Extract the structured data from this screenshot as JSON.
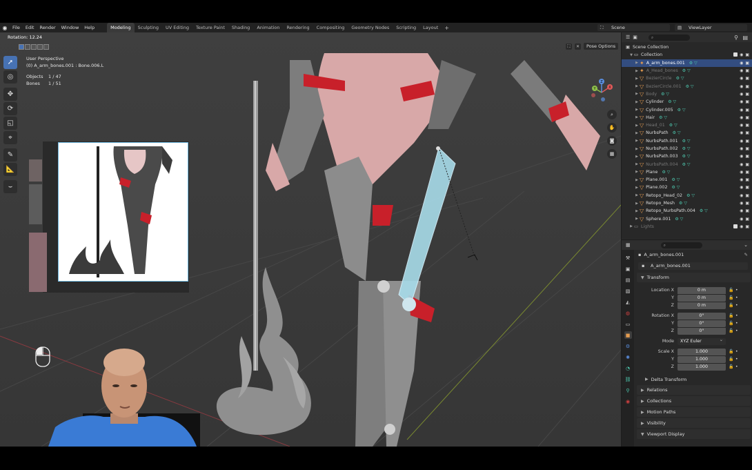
{
  "menubar": {
    "menus": [
      "File",
      "Edit",
      "Render",
      "Window",
      "Help"
    ],
    "workspaces": [
      "Modeling",
      "Sculpting",
      "UV Editing",
      "Texture Paint",
      "Shading",
      "Animation",
      "Rendering",
      "Compositing",
      "Geometry Nodes",
      "Scripting",
      "Layout"
    ],
    "active_workspace": "Modeling",
    "scene": "Scene",
    "view_layer": "ViewLayer"
  },
  "viewport": {
    "operator_label": "Rotation: 12.24",
    "view_name": "User Perspective",
    "active_info": "(0) A_arm_bones.001 : Bone.006.L",
    "objects_label": "Objects",
    "objects_value": "1 / 47",
    "bones_label": "Bones",
    "bones_value": "1 / 51",
    "pose_options": "Pose Options",
    "gizmo_axes": {
      "x": "X",
      "y": "Y",
      "z": "Z"
    }
  },
  "outliner": {
    "scene_collection": "Scene Collection",
    "collection": "Collection",
    "items": [
      {
        "name": "A_arm_bones.001",
        "state": "selected"
      },
      {
        "name": "A_Head_bones",
        "state": "dim"
      },
      {
        "name": "BezierCircle",
        "state": "dim"
      },
      {
        "name": "BezierCircle.001",
        "state": "dim"
      },
      {
        "name": "Body",
        "state": "dim"
      },
      {
        "name": "Cylinder",
        "state": "normal"
      },
      {
        "name": "Cylinder.005",
        "state": "normal"
      },
      {
        "name": "Hair",
        "state": "normal"
      },
      {
        "name": "Head_01",
        "state": "dim"
      },
      {
        "name": "NurbsPath",
        "state": "normal"
      },
      {
        "name": "NurbsPath.001",
        "state": "normal"
      },
      {
        "name": "NurbsPath.002",
        "state": "normal"
      },
      {
        "name": "NurbsPath.003",
        "state": "normal"
      },
      {
        "name": "NurbsPath.004",
        "state": "dim"
      },
      {
        "name": "Plane",
        "state": "normal"
      },
      {
        "name": "Plane.001",
        "state": "normal"
      },
      {
        "name": "Plane.002",
        "state": "normal"
      },
      {
        "name": "Retopo_Head_02",
        "state": "normal"
      },
      {
        "name": "Retopo_Mesh",
        "state": "normal"
      },
      {
        "name": "Retopo_NurbsPath.004",
        "state": "normal"
      },
      {
        "name": "Sphere.001",
        "state": "normal"
      }
    ],
    "lights": "Lights"
  },
  "properties": {
    "object_name": "A_arm_bones.001",
    "data_name": "A_arm_bones.001",
    "transform_header": "Transform",
    "location_label": "Location X",
    "location": {
      "x": "0 m",
      "y": "0 m",
      "z": "0 m"
    },
    "rotation_label": "Rotation X",
    "rotation": {
      "x": "0°",
      "y": "0°",
      "z": "0°"
    },
    "mode_label": "Mode",
    "mode_value": "XYZ Euler",
    "scale_label": "Scale X",
    "scale": {
      "x": "1.000",
      "y": "1.000",
      "z": "1.000"
    },
    "axis_y": "Y",
    "axis_z": "Z",
    "delta_transform": "Delta Transform",
    "panels": [
      "Relations",
      "Collections",
      "Motion Paths",
      "Visibility",
      "Viewport Display"
    ]
  },
  "colors": {
    "accent": "#4772b3",
    "selection": "#334d80",
    "armor_red": "#c8202a",
    "bone_highlight": "#a8dcea"
  }
}
